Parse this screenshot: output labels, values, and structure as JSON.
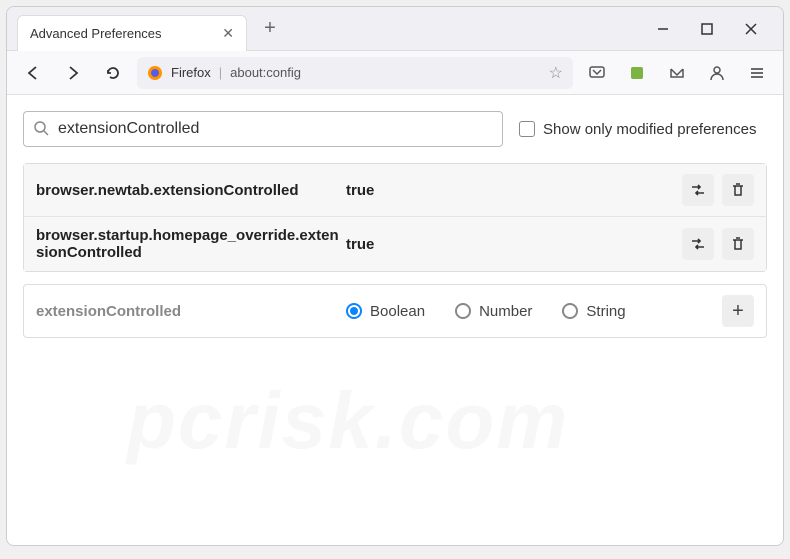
{
  "window": {
    "tab_title": "Advanced Preferences"
  },
  "urlbar": {
    "brand": "Firefox",
    "address": "about:config"
  },
  "search": {
    "value": "extensionControlled",
    "checkbox_label": "Show only modified preferences"
  },
  "prefs": [
    {
      "name": "browser.newtab.extensionControlled",
      "value": "true"
    },
    {
      "name": "browser.startup.homepage_override.extensionControlled",
      "value": "true"
    }
  ],
  "new_pref": {
    "name": "extensionControlled",
    "types": [
      "Boolean",
      "Number",
      "String"
    ],
    "selected": "Boolean"
  },
  "watermark": "pcrisk.com"
}
